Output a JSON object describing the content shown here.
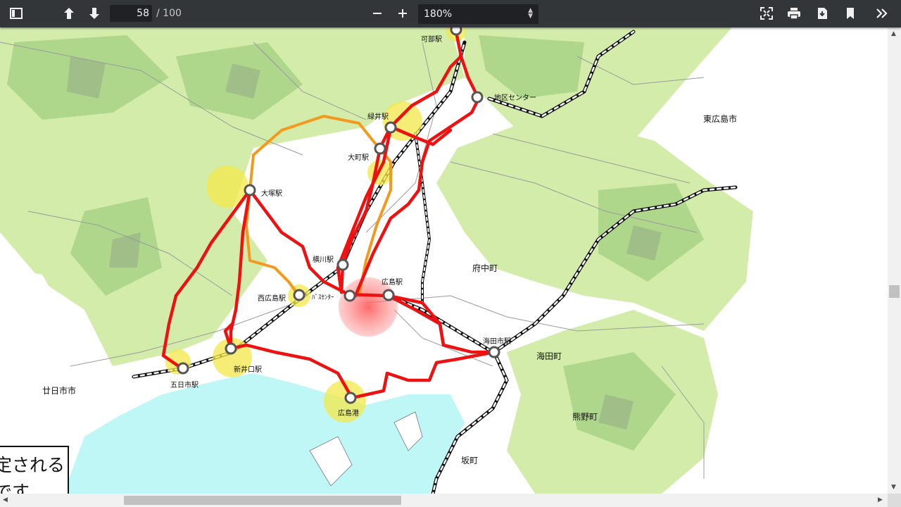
{
  "toolbar": {
    "page_current": "58",
    "page_total": "/ 100",
    "zoom": "180%",
    "icons": [
      "sidebar-toggle-icon",
      "arrow-up-icon",
      "arrow-down-icon",
      "zoom-out-icon",
      "zoom-in-icon",
      "fit-page-icon",
      "print-icon",
      "download-icon",
      "bookmark-icon",
      "more-tools-icon"
    ]
  },
  "map": {
    "stations": {
      "kabe": "可部駅",
      "chiku_center": "地区センター",
      "midorii": "緑井駅",
      "omachi": "大町駅",
      "otsuka": "大塚駅",
      "yokogawa": "横川駅",
      "nishihiroshima": "西広島駅",
      "bus_center": "ﾊﾞｽｾﾝﾀｰ",
      "hiroshima": "広島駅",
      "kaitaichi": "海田市駅",
      "shinkoguchi": "新井口駅",
      "itsukaichi": "五日市駅",
      "hiroshima_port": "広島港"
    },
    "towns": {
      "higashihiroshima": "東広島市",
      "fuchu": "府中町",
      "kaita": "海田町",
      "kumano": "熊野町",
      "saka": "坂町",
      "hatsukaichi": "廿日市市"
    },
    "note_lines": [
      "定される",
      "です"
    ],
    "colors": {
      "rail_red": "#ee1111",
      "rail_orange": "#f39a1e",
      "water": "#bff7f7",
      "hub": "#f4e84a"
    }
  }
}
